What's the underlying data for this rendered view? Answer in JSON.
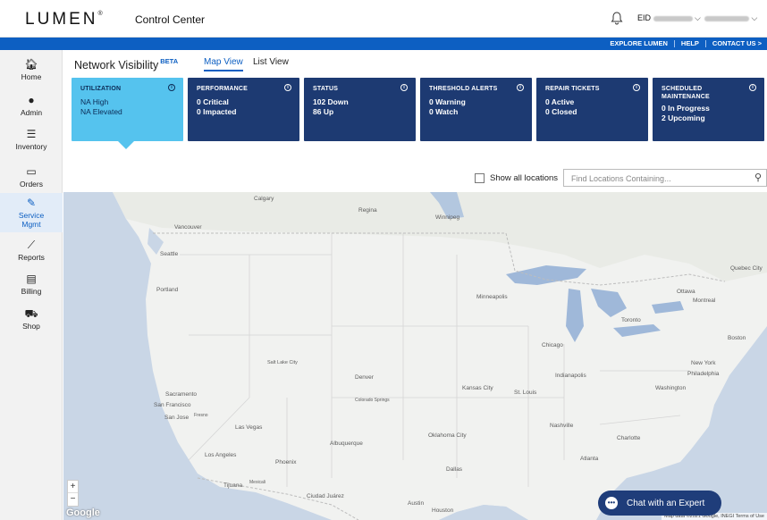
{
  "header": {
    "logo": "LUMEN",
    "logo_mark": "®",
    "app_name": "Control Center",
    "eid_label": "EID"
  },
  "utility_nav": [
    "EXPLORE LUMEN",
    "HELP",
    "CONTACT US >"
  ],
  "sidebar": [
    {
      "label": "Home",
      "icon": "home-icon",
      "glyph": "⌂"
    },
    {
      "label": "Admin",
      "icon": "admin-user-icon",
      "glyph": "☻"
    },
    {
      "label": "Inventory",
      "icon": "inventory-list-icon",
      "glyph": "☰"
    },
    {
      "label": "Orders",
      "icon": "orders-tray-icon",
      "glyph": "▭"
    },
    {
      "label": "Service\nMgmt",
      "icon": "wrench-icon",
      "glyph": "🔧"
    },
    {
      "label": "Reports",
      "icon": "reports-chart-icon",
      "glyph": "⟋"
    },
    {
      "label": "Billing",
      "icon": "billing-document-icon",
      "glyph": "▤"
    },
    {
      "label": "Shop",
      "icon": "shop-cart-icon",
      "glyph": "⛟"
    }
  ],
  "page": {
    "title": "Network Visibility",
    "badge": "BETA",
    "tabs": [
      "Map View",
      "List View"
    ],
    "active_tab": "Map View"
  },
  "cards": [
    {
      "title": "UTILIZATION",
      "lines": [
        "NA High",
        "NA Elevated"
      ]
    },
    {
      "title": "PERFORMANCE",
      "lines": [
        "0 Critical",
        "0 Impacted"
      ]
    },
    {
      "title": "STATUS",
      "lines": [
        "102 Down",
        "86 Up"
      ]
    },
    {
      "title": "THRESHOLD ALERTS",
      "lines": [
        "0 Warning",
        "0 Watch"
      ]
    },
    {
      "title": "REPAIR TICKETS",
      "lines": [
        "0 Active",
        "0 Closed"
      ]
    },
    {
      "title": "SCHEDULED MAINTENANCE",
      "lines": [
        "0 In Progress",
        "2 Upcoming"
      ]
    }
  ],
  "filters": {
    "show_all_label": "Show all locations",
    "show_all_checked": false,
    "search_placeholder": "Find Locations Containing..."
  },
  "map": {
    "cities": [
      "Calgary",
      "Regina",
      "Winnipeg",
      "Vancouver",
      "Seattle",
      "Portland",
      "Minneapolis",
      "Quebec City",
      "Ottawa",
      "Montreal",
      "Toronto",
      "Chicago",
      "Boston",
      "Salt Lake City",
      "Denver",
      "Colorado Springs",
      "Kansas City",
      "St. Louis",
      "Indianapolis",
      "New York",
      "Philadelphia",
      "Washington",
      "Sacramento",
      "San Francisco",
      "San Jose",
      "Fresno",
      "Las Vegas",
      "Albuquerque",
      "Oklahoma City",
      "Nashville",
      "Charlotte",
      "Atlanta",
      "Los Angeles",
      "Phoenix",
      "Dallas",
      "Tijuana",
      "Mexicali",
      "Ciudad Juárez",
      "Austin",
      "Houston"
    ],
    "zoom_in": "+",
    "zoom_out": "−",
    "brand": "Google",
    "attribution": "Map data ©2021 Google, INEGI   Terms of Use"
  },
  "chat": {
    "label": "Chat with an Expert"
  },
  "colors": {
    "accent": "#0d5fc2",
    "card": "#1d3a72",
    "card_active": "#55c3ee"
  }
}
